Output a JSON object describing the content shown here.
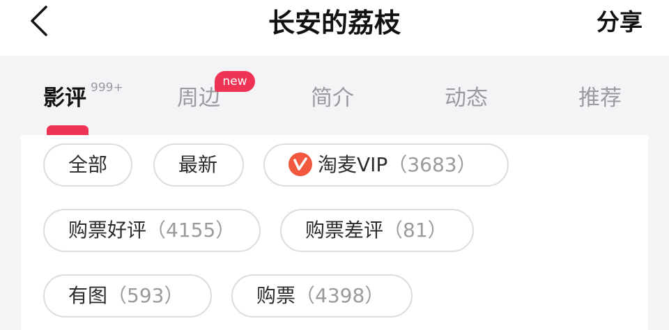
{
  "header": {
    "title": "长安的荔枝",
    "share_label": "分享",
    "back_icon": "chevron-left-icon"
  },
  "tabs": [
    {
      "label": "影评",
      "count": "999+",
      "active": true
    },
    {
      "label": "周边",
      "badge": "new"
    },
    {
      "label": "简介"
    },
    {
      "label": "动态"
    },
    {
      "label": "推荐"
    }
  ],
  "filters": [
    {
      "label": "全部",
      "count": ""
    },
    {
      "label": "最新",
      "count": ""
    },
    {
      "label": "淘麦VIP",
      "count": "（3683）",
      "icon": "taomai-vip-icon"
    },
    {
      "label": "购票好评",
      "count": "（4155）"
    },
    {
      "label": "购票差评",
      "count": "（81）"
    },
    {
      "label": "有图",
      "count": "（593）"
    },
    {
      "label": "购票",
      "count": "（4398）"
    }
  ],
  "colors": {
    "accent": "#ee3355",
    "vip": "#f2583e"
  }
}
